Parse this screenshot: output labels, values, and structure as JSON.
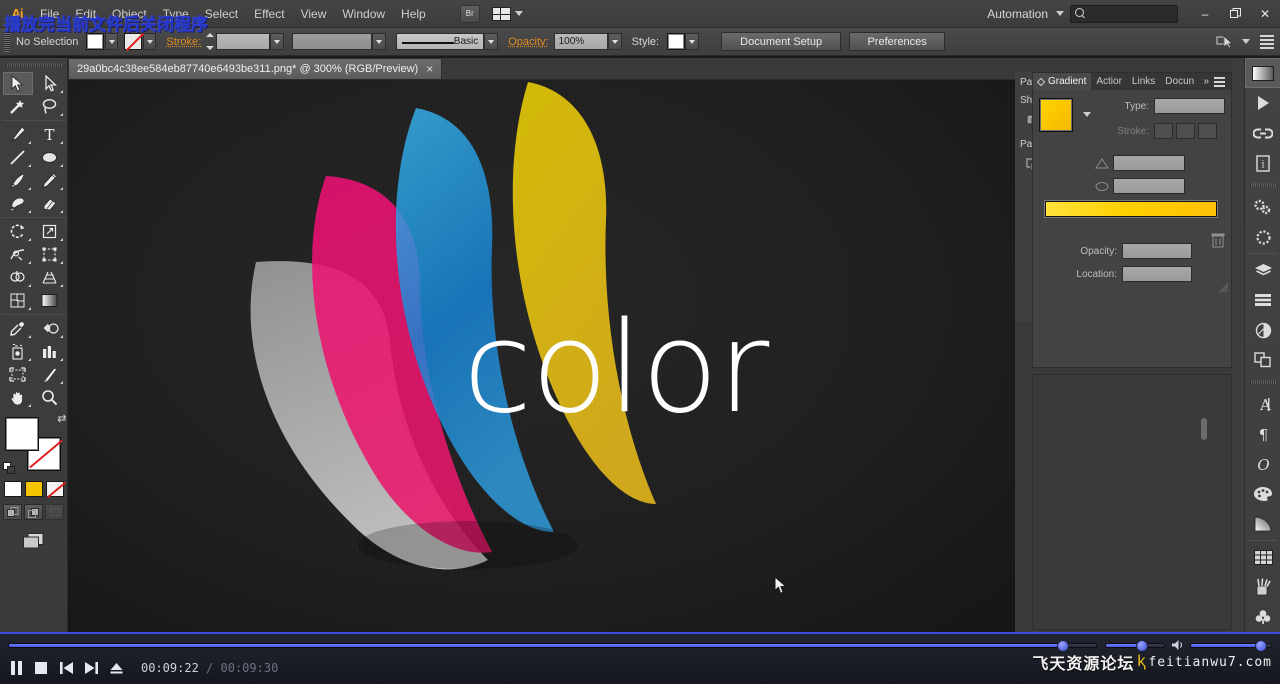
{
  "app": {
    "logo": "Ai",
    "menus": [
      "File",
      "Edit",
      "Object",
      "Type",
      "Select",
      "Effect",
      "View",
      "Window",
      "Help"
    ],
    "bridge_button": "Br",
    "arrange_documents": "arrange-documents",
    "automation_label": "Automation",
    "search_placeholder": "",
    "search_value": "",
    "window_buttons": {
      "minimize": "–",
      "restore": "❐",
      "close": "✕"
    }
  },
  "overlay": {
    "text": "播放完当前文件后关闭程序",
    "color": "#2437c8"
  },
  "control_bar": {
    "selection_status": "No Selection",
    "fill_swatch": "#ffffff",
    "stroke_swatch": "none",
    "stroke_label": "Stroke:",
    "stroke_weight": "",
    "stroke_profile": "",
    "brush_definition": "Basic",
    "opacity_label": "Opacity:",
    "opacity_value": "100%",
    "style_label": "Style:",
    "style_swatch": "#ffffff",
    "document_setup_button": "Document Setup",
    "preferences_button": "Preferences"
  },
  "document": {
    "tab_title": "29a0bc4c38ee584eb87740e6493be311.png* @ 300% (RGB/Preview)",
    "close_glyph": "×",
    "zoom": "300%",
    "color_mode": "RGB/Preview",
    "modified": true
  },
  "tools": {
    "left_column": [
      {
        "name": "selection-tool",
        "selected": true
      },
      {
        "name": "magic-wand-tool",
        "selected": false
      },
      {
        "name": "pen-tool",
        "selected": false
      },
      {
        "name": "line-segment-tool",
        "selected": false
      },
      {
        "name": "paintbrush-tool",
        "selected": false
      },
      {
        "name": "blob-brush-tool",
        "selected": false
      },
      {
        "name": "rotate-tool",
        "selected": false
      },
      {
        "name": "width-tool",
        "selected": false
      },
      {
        "name": "shape-builder-tool",
        "selected": false
      },
      {
        "name": "mesh-tool",
        "selected": false
      },
      {
        "name": "eyedropper-tool",
        "selected": false
      },
      {
        "name": "symbol-sprayer-tool",
        "selected": false
      },
      {
        "name": "artboard-tool",
        "selected": false
      },
      {
        "name": "hand-tool",
        "selected": false
      }
    ],
    "right_column": [
      {
        "name": "direct-selection-tool",
        "selected": false
      },
      {
        "name": "lasso-tool",
        "selected": false
      },
      {
        "name": "type-tool",
        "selected": false
      },
      {
        "name": "ellipse-tool",
        "selected": false
      },
      {
        "name": "pencil-tool",
        "selected": false
      },
      {
        "name": "eraser-tool",
        "selected": false
      },
      {
        "name": "scale-tool",
        "selected": false
      },
      {
        "name": "free-transform-tool",
        "selected": false
      },
      {
        "name": "perspective-grid-tool",
        "selected": false
      },
      {
        "name": "gradient-tool",
        "selected": false
      },
      {
        "name": "blend-tool",
        "selected": false
      },
      {
        "name": "column-graph-tool",
        "selected": false
      },
      {
        "name": "slice-tool",
        "selected": false
      },
      {
        "name": "zoom-tool",
        "selected": false
      }
    ],
    "fill_color": "#ffffff",
    "stroke_color": "none",
    "color_mode_buttons": [
      "color",
      "gradient",
      "none"
    ],
    "gradient_button_color": "#f5c400",
    "drawing_modes": [
      "draw-normal",
      "draw-behind",
      "draw-inside"
    ],
    "screen_mode": "change-screen-mode"
  },
  "artwork": {
    "wordmark": "color",
    "wordmark_color": "#ffffff",
    "petals": [
      {
        "name": "petal-gray",
        "color": "#8a8a8a"
      },
      {
        "name": "petal-magenta",
        "color": "#ed1164"
      },
      {
        "name": "petal-cyan",
        "color": "#1b9de0"
      },
      {
        "name": "petal-yellow",
        "color": "#ffe000"
      }
    ],
    "background": "#1f1f1f"
  },
  "right_dock": {
    "collapsed_panels": [
      {
        "label": "Pathfir",
        "icon": "pathfinder-icon"
      },
      {
        "label": "Shape I",
        "icon": "shape-modes-icon"
      },
      {
        "label": "Pathfinc",
        "icon": "pathfinders-icon"
      }
    ],
    "panel_tabs": [
      {
        "label": "Gradient",
        "active": true
      },
      {
        "label": "Actior",
        "active": false
      },
      {
        "label": "Links",
        "active": false
      },
      {
        "label": "Docun",
        "active": false
      }
    ],
    "gradient_panel": {
      "title": "Gradient",
      "swatch_color": "#ffd400",
      "type_label": "Type:",
      "type_value": "",
      "stroke_label": "Stroke:",
      "angle_value": "",
      "aspect_value": "",
      "gradient_bar_start": "#ffe23a",
      "gradient_bar_end": "#ffc107",
      "opacity_label": "Opacity:",
      "opacity_value": "",
      "location_label": "Location:",
      "location_value": ""
    },
    "icon_rail": [
      {
        "name": "color-panel-icon",
        "selected": true
      },
      {
        "name": "actions-panel-icon",
        "selected": false
      },
      {
        "name": "links-panel-icon",
        "selected": false
      },
      {
        "name": "document-info-panel-icon",
        "selected": false
      },
      {
        "name": "graphic-styles-panel-icon",
        "selected": false
      },
      {
        "name": "symbols-panel-icon",
        "selected": false
      },
      {
        "name": "layers-panel-icon",
        "selected": false
      },
      {
        "name": "align-panel-icon",
        "selected": false
      },
      {
        "name": "transparency-panel-icon",
        "selected": false
      },
      {
        "name": "pathfinder-panel-icon",
        "selected": false
      },
      {
        "name": "character-panel-icon",
        "selected": false
      },
      {
        "name": "paragraph-panel-icon",
        "selected": false
      },
      {
        "name": "opentype-panel-icon",
        "selected": false
      },
      {
        "name": "swatches-panel-icon",
        "selected": false
      },
      {
        "name": "gradient-panel-icon",
        "selected": false
      },
      {
        "name": "color-guide-panel-icon",
        "selected": false
      },
      {
        "name": "brushes-panel-icon",
        "selected": false
      },
      {
        "name": "symbols-library-panel-icon",
        "selected": false
      }
    ]
  },
  "player": {
    "buttons": [
      {
        "name": "pause-button",
        "glyph": "pause"
      },
      {
        "name": "stop-button",
        "glyph": "stop"
      },
      {
        "name": "previous-button",
        "glyph": "prev"
      },
      {
        "name": "next-button",
        "glyph": "next"
      },
      {
        "name": "eject-button",
        "glyph": "eject"
      }
    ],
    "current_time": "00:09:22",
    "separator": "/",
    "total_time": "00:09:30",
    "progress_percent": 97,
    "position_slider_percent": 62,
    "volume_percent": 88,
    "accent_color": "#4a57e0"
  },
  "watermark": {
    "chinese": "飞天资源论坛",
    "flame": "ⱪ",
    "english": "feitianwu7.com"
  }
}
